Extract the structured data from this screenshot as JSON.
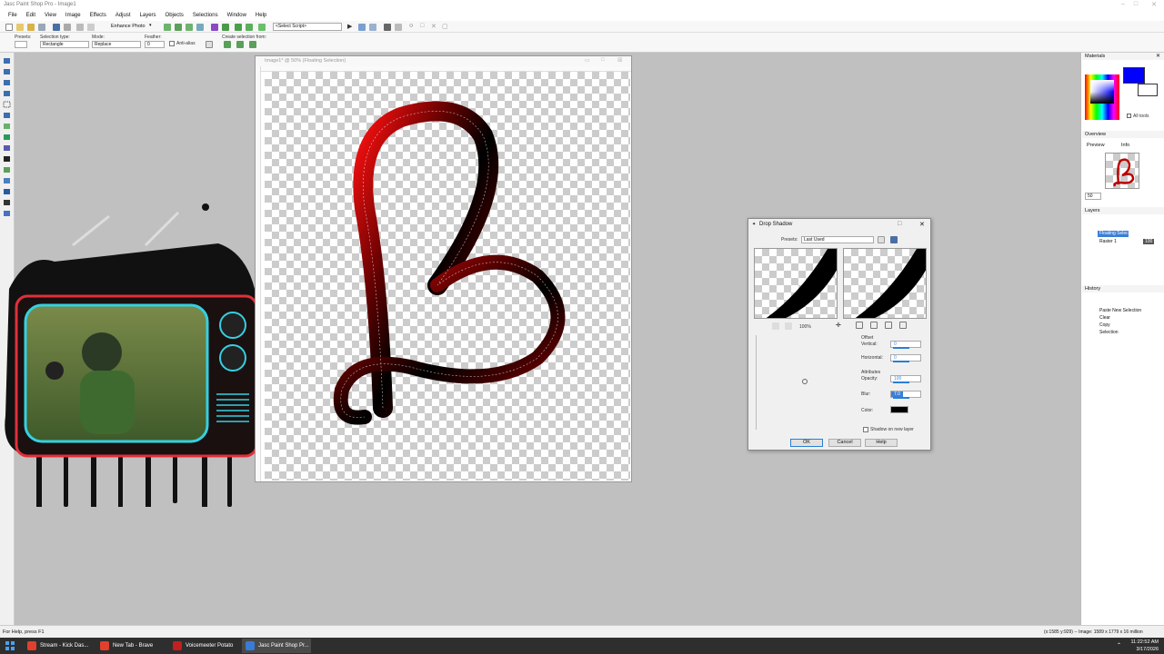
{
  "app": {
    "title": "Jasc Paint Shop Pro - Image1"
  },
  "menu": [
    "File",
    "Edit",
    "View",
    "Image",
    "Effects",
    "Adjust",
    "Layers",
    "Objects",
    "Selections",
    "Window",
    "Help"
  ],
  "toolbar": {
    "enhance_photo": "Enhance Photo",
    "select_script": "<Select Script>"
  },
  "tool_options": {
    "presets_label": "Presets:",
    "selection_type_label": "Selection type:",
    "selection_type_value": "Rectangle",
    "mode_label": "Mode:",
    "mode_value": "Replace",
    "feather_label": "Feather:",
    "feather_value": "0",
    "antialias_label": "Anti-alias",
    "create_from_label": "Create selection from:"
  },
  "image_window": {
    "title": "Image1* @ 50% (Floating Selection)"
  },
  "dialog": {
    "title": "Drop Shadow",
    "presets_label": "Presets:",
    "presets_value": "Last Used",
    "zoom_value": "100%",
    "offset_label": "Offset",
    "vertical_label": "Vertical:",
    "vertical_value": "0",
    "horizontal_label": "Horizontal:",
    "horizontal_value": "0",
    "attributes_label": "Attributes",
    "opacity_label": "Opacity:",
    "opacity_value": "100",
    "blur_label": "Blur:",
    "blur_value": "7.0",
    "color_label": "Color:",
    "shadow_new_layer_label": "Shadow on new layer",
    "ok": "OK",
    "cancel": "Cancel",
    "help": "Help",
    "shadow_color": "#000000"
  },
  "panels": {
    "materials": {
      "title": "Materials",
      "all_tools": "All tools",
      "fg_color": "#0000ff"
    },
    "overview": {
      "title": "Overview",
      "tab_preview": "Preview",
      "tab_info": "Info",
      "zoom": "50"
    },
    "layers": {
      "title": "Layers",
      "items": [
        {
          "name": "Floating Selec",
          "opacity": ""
        },
        {
          "name": "Raster 1",
          "opacity": "100"
        }
      ]
    },
    "history": {
      "title": "History",
      "items": [
        "Paste New Selection",
        "Clear",
        "Copy",
        "Selection"
      ]
    }
  },
  "status": {
    "left": "For Help, press F1",
    "right": "(x:1585 y:929) -- Image: 1589 x 1779 x 16 million"
  },
  "taskbar": {
    "items": [
      {
        "label": "Stream - Kick Das...",
        "color": "#e0402c"
      },
      {
        "label": "New Tab - Brave",
        "color": "#e0402c"
      },
      {
        "label": "Voicemeeter Potato",
        "color": "#c02020"
      },
      {
        "label": "Jasc Paint Shop Pr...",
        "color": "#3a7bd5"
      }
    ],
    "time": "11:22:52 AM",
    "date": "3/17/2026"
  }
}
